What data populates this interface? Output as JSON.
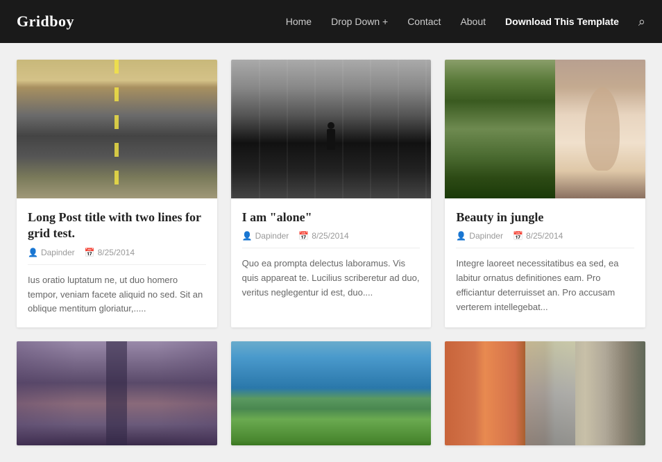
{
  "header": {
    "logo": "Gridboy",
    "nav": {
      "home": "Home",
      "dropdown": "Drop Down +",
      "contact": "Contact",
      "about": "About",
      "download": "Download This Template"
    }
  },
  "cards": [
    {
      "id": "card-1",
      "title": "Long Post title with two lines for grid test.",
      "author": "Dapinder",
      "date": "8/25/2014",
      "excerpt": "Ius oratio luptatum ne, ut duo homero tempor, veniam facete aliquid no sed. Sit an oblique mentitum gloriatur,.....",
      "image_type": "road"
    },
    {
      "id": "card-2",
      "title": "I am \"alone\"",
      "author": "Dapinder",
      "date": "8/25/2014",
      "excerpt": "Quo ea prompta delectus laboramus. Vis quis appareat te. Lucilius scriberetur ad duo, veritus neglegentur id est, duo....",
      "image_type": "alone"
    },
    {
      "id": "card-3",
      "title": "Beauty in jungle",
      "author": "Dapinder",
      "date": "8/25/2014",
      "excerpt": "Integre laoreet necessitatibus ea sed, ea labitur ornatus definitiones eam. Pro efficiantur deterruisset an. Pro accusam verterem intellegebat...",
      "image_type": "jungle"
    },
    {
      "id": "card-4",
      "title": "",
      "author": "",
      "date": "",
      "excerpt": "",
      "image_type": "city"
    },
    {
      "id": "card-5",
      "title": "",
      "author": "",
      "date": "",
      "excerpt": "",
      "image_type": "bay"
    },
    {
      "id": "card-6",
      "title": "",
      "author": "",
      "date": "",
      "excerpt": "",
      "image_type": "alley"
    }
  ],
  "icons": {
    "search": "🔍",
    "user": "👤",
    "calendar": "📅"
  }
}
